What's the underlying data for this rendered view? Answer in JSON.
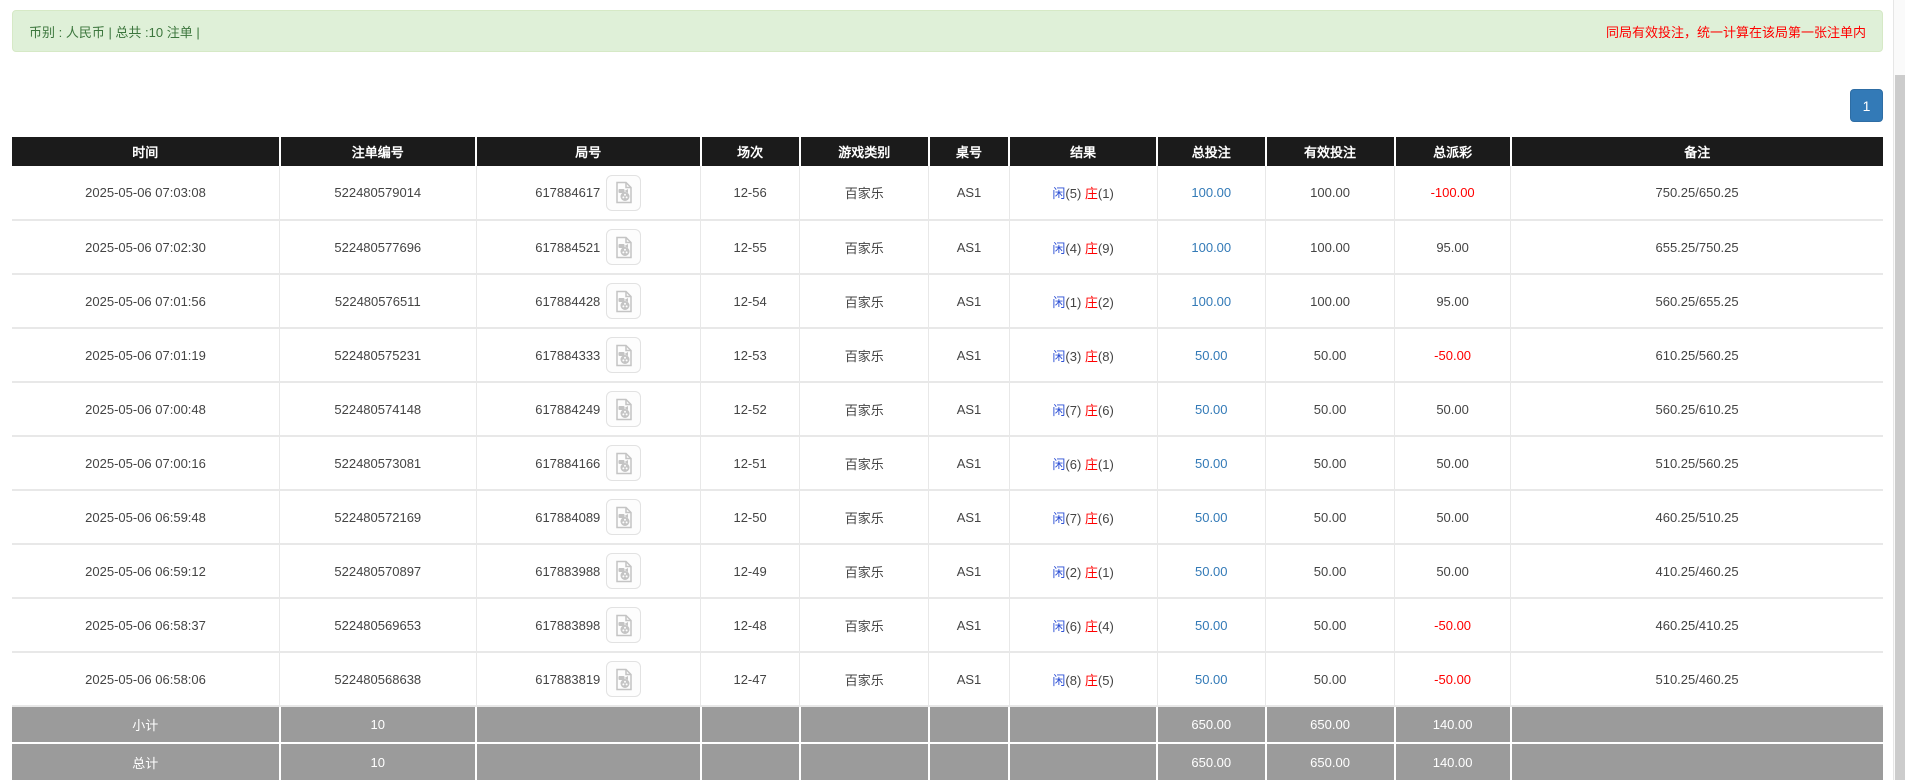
{
  "top_bar": {
    "summary": "币别 : 人民币 | 总共 :10 注单 |",
    "notice": "同局有效投注，统一计算在该局第一张注单内"
  },
  "pagination": {
    "current_page": "1"
  },
  "colors": {
    "header_bg": "#1b1b1b",
    "link_blue": "#337ab7",
    "player_blue": "#2d50d5",
    "banker_red": "#ff0000",
    "negative_red": "#ff0000",
    "footer_gray": "#9b9b9b",
    "alert_green_bg": "#dff0d8",
    "alert_text_green": "#3c763d"
  },
  "table": {
    "headers": [
      "时间",
      "注单编号",
      "局号",
      "场次",
      "游戏类别",
      "桌号",
      "结果",
      "总投注",
      "有效投注",
      "总派彩",
      "备注"
    ],
    "rows": [
      {
        "time": "2025-05-06 07:03:08",
        "bet_id": "522480579014",
        "round_id": "617884617",
        "session": "12-56",
        "game": "百家乐",
        "table_no": "AS1",
        "player_label": "闲",
        "player_score": "(5)",
        "banker_label": "庄",
        "banker_score": "(1)",
        "total_bet": "100.00",
        "valid_bet": "100.00",
        "payout": "-100.00",
        "remark": "750.25/650.25"
      },
      {
        "time": "2025-05-06 07:02:30",
        "bet_id": "522480577696",
        "round_id": "617884521",
        "session": "12-55",
        "game": "百家乐",
        "table_no": "AS1",
        "player_label": "闲",
        "player_score": "(4)",
        "banker_label": "庄",
        "banker_score": "(9)",
        "total_bet": "100.00",
        "valid_bet": "100.00",
        "payout": "95.00",
        "remark": "655.25/750.25"
      },
      {
        "time": "2025-05-06 07:01:56",
        "bet_id": "522480576511",
        "round_id": "617884428",
        "session": "12-54",
        "game": "百家乐",
        "table_no": "AS1",
        "player_label": "闲",
        "player_score": "(1)",
        "banker_label": "庄",
        "banker_score": "(2)",
        "total_bet": "100.00",
        "valid_bet": "100.00",
        "payout": "95.00",
        "remark": "560.25/655.25"
      },
      {
        "time": "2025-05-06 07:01:19",
        "bet_id": "522480575231",
        "round_id": "617884333",
        "session": "12-53",
        "game": "百家乐",
        "table_no": "AS1",
        "player_label": "闲",
        "player_score": "(3)",
        "banker_label": "庄",
        "banker_score": "(8)",
        "total_bet": "50.00",
        "valid_bet": "50.00",
        "payout": "-50.00",
        "remark": "610.25/560.25"
      },
      {
        "time": "2025-05-06 07:00:48",
        "bet_id": "522480574148",
        "round_id": "617884249",
        "session": "12-52",
        "game": "百家乐",
        "table_no": "AS1",
        "player_label": "闲",
        "player_score": "(7)",
        "banker_label": "庄",
        "banker_score": "(6)",
        "total_bet": "50.00",
        "valid_bet": "50.00",
        "payout": "50.00",
        "remark": "560.25/610.25"
      },
      {
        "time": "2025-05-06 07:00:16",
        "bet_id": "522480573081",
        "round_id": "617884166",
        "session": "12-51",
        "game": "百家乐",
        "table_no": "AS1",
        "player_label": "闲",
        "player_score": "(6)",
        "banker_label": "庄",
        "banker_score": "(1)",
        "total_bet": "50.00",
        "valid_bet": "50.00",
        "payout": "50.00",
        "remark": "510.25/560.25"
      },
      {
        "time": "2025-05-06 06:59:48",
        "bet_id": "522480572169",
        "round_id": "617884089",
        "session": "12-50",
        "game": "百家乐",
        "table_no": "AS1",
        "player_label": "闲",
        "player_score": "(7)",
        "banker_label": "庄",
        "banker_score": "(6)",
        "total_bet": "50.00",
        "valid_bet": "50.00",
        "payout": "50.00",
        "remark": "460.25/510.25"
      },
      {
        "time": "2025-05-06 06:59:12",
        "bet_id": "522480570897",
        "round_id": "617883988",
        "session": "12-49",
        "game": "百家乐",
        "table_no": "AS1",
        "player_label": "闲",
        "player_score": "(2)",
        "banker_label": "庄",
        "banker_score": "(1)",
        "total_bet": "50.00",
        "valid_bet": "50.00",
        "payout": "50.00",
        "remark": "410.25/460.25"
      },
      {
        "time": "2025-05-06 06:58:37",
        "bet_id": "522480569653",
        "round_id": "617883898",
        "session": "12-48",
        "game": "百家乐",
        "table_no": "AS1",
        "player_label": "闲",
        "player_score": "(6)",
        "banker_label": "庄",
        "banker_score": "(4)",
        "total_bet": "50.00",
        "valid_bet": "50.00",
        "payout": "-50.00",
        "remark": "460.25/410.25"
      },
      {
        "time": "2025-05-06 06:58:06",
        "bet_id": "522480568638",
        "round_id": "617883819",
        "session": "12-47",
        "game": "百家乐",
        "table_no": "AS1",
        "player_label": "闲",
        "player_score": "(8)",
        "banker_label": "庄",
        "banker_score": "(5)",
        "total_bet": "50.00",
        "valid_bet": "50.00",
        "payout": "-50.00",
        "remark": "510.25/460.25"
      }
    ],
    "subtotal": {
      "label": "小计",
      "count": "10",
      "total_bet": "650.00",
      "valid_bet": "650.00",
      "payout": "140.00"
    },
    "total": {
      "label": "总计",
      "count": "10",
      "total_bet": "650.00",
      "valid_bet": "650.00",
      "payout": "140.00"
    }
  }
}
